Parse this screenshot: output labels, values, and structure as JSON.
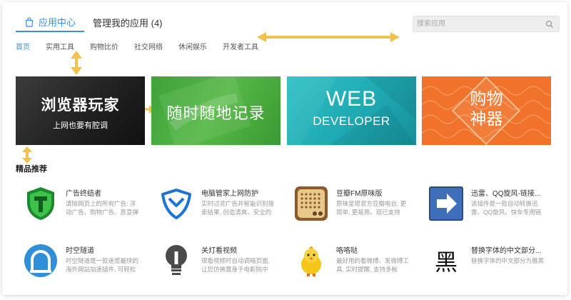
{
  "tabs": [
    {
      "label": "应用中心",
      "active": true
    },
    {
      "label": "管理我的应用 (4)",
      "active": false
    }
  ],
  "search": {
    "placeholder": "搜索应用"
  },
  "subnav": [
    "首页",
    "实用工具",
    "购物比价",
    "社交网络",
    "休闲娱乐",
    "开发者工具"
  ],
  "banners": [
    {
      "title": "浏览器玩家",
      "subtitle": "上网也要有腔调"
    },
    {
      "title": "随时随地记录"
    },
    {
      "title": "WEB",
      "subtitle": "DEVELOPER"
    },
    {
      "title_line1": "购物",
      "title_line2": "神器"
    }
  ],
  "section_title": "精品推荐",
  "apps": [
    {
      "name": "广告终结者",
      "desc": "清除网页上的所有广告: 浮动广告、购物广告、恶意弹窗...",
      "icon": "shield-t-icon"
    },
    {
      "name": "电脑管家上网防护",
      "desc": "实时过滤广告并智能识别搜索结果, 创造清爽、安全的上...",
      "icon": "tencent-shield-icon"
    },
    {
      "name": "豆瓣FM原味版",
      "desc": "原味呈现官方豆瓣电台, 更简单, 更易用。现已支持pro...",
      "icon": "radio-icon"
    },
    {
      "name": "迅雷、QQ旋风-链接...",
      "desc": "该插件是一款自动转换迅雷、QQ旋风、快车专用链的工...",
      "icon": "arrow-right-icon"
    },
    {
      "name": "时空隧道",
      "desc": "时空隧道是一款速度最快的海外网站加速插件, 可轻松访...",
      "icon": "tunnel-icon"
    },
    {
      "name": "关灯看视频",
      "desc": "观看视频时自动调暗页面, 让您仿佛置身于电影院中",
      "icon": "bulb-icon"
    },
    {
      "name": "咯咯哒",
      "desc": "最好用的看微博、发微博工具, 实时提醒, 支持多帐号。",
      "icon": "chick-icon"
    },
    {
      "name": "替换字体的中文部分...",
      "desc": "替换字体的中文部分为雅黑",
      "icon": "hei-char-icon",
      "icon_char": "黑"
    }
  ],
  "colors": {
    "accent": "#3a8ee6",
    "annotation_arrow": "#f2c14e"
  }
}
